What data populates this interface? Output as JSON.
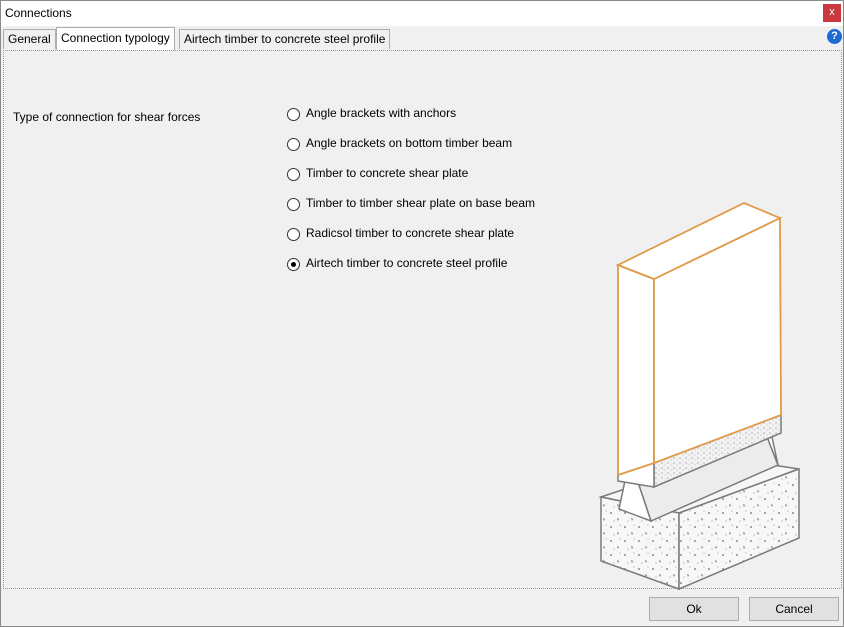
{
  "window": {
    "title": "Connections",
    "close_label": "x"
  },
  "tabs": [
    {
      "label": "General"
    },
    {
      "label": "Connection typology"
    },
    {
      "label": "Airtech timber to concrete steel profile"
    }
  ],
  "help_label": "?",
  "shear": {
    "label": "Type of connection for shear forces",
    "options": [
      {
        "label": "Angle brackets with anchors",
        "selected": false
      },
      {
        "label": "Angle brackets on bottom timber beam",
        "selected": false
      },
      {
        "label": "Timber to concrete shear plate",
        "selected": false
      },
      {
        "label": "Timber to timber shear plate on base beam",
        "selected": false
      },
      {
        "label": "Radicsol timber to concrete shear plate",
        "selected": false
      },
      {
        "label": "Airtech timber to concrete steel profile",
        "selected": true
      }
    ]
  },
  "colors": {
    "timber_outline": "#e09a4a",
    "steel_outline": "#7a7a7a"
  },
  "buttons": {
    "ok": "Ok",
    "cancel": "Cancel"
  }
}
